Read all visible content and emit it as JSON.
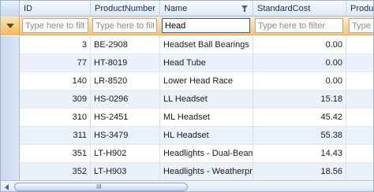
{
  "columns": [
    {
      "key": "id",
      "label": "ID",
      "filter_value": "",
      "filter_placeholder": "Type here to filter"
    },
    {
      "key": "product_number",
      "label": "ProductNumber",
      "filter_value": "",
      "filter_placeholder": "Type here to filter"
    },
    {
      "key": "name",
      "label": "Name",
      "filter_value": "Head",
      "filter_placeholder": "Type here to filter",
      "filtered": true
    },
    {
      "key": "standard_cost",
      "label": "StandardCost",
      "filter_value": "",
      "filter_placeholder": "Type here to filter"
    },
    {
      "key": "product_more",
      "label": "Product",
      "filter_value": "",
      "filter_placeholder": "Type here to filter"
    }
  ],
  "rows": [
    {
      "id": "3",
      "product_number": "BE-2908",
      "name": "Headset Ball Bearings",
      "standard_cost": "0.00"
    },
    {
      "id": "77",
      "product_number": "HT-8019",
      "name": "Head Tube",
      "standard_cost": "0.00"
    },
    {
      "id": "140",
      "product_number": "LR-8520",
      "name": "Lower Head Race",
      "standard_cost": "0.00"
    },
    {
      "id": "309",
      "product_number": "HS-0296",
      "name": "LL Headset",
      "standard_cost": "15.18"
    },
    {
      "id": "310",
      "product_number": "HS-2451",
      "name": "ML Headset",
      "standard_cost": "45.42"
    },
    {
      "id": "311",
      "product_number": "HS-3479",
      "name": "HL Headset",
      "standard_cost": "55.38"
    },
    {
      "id": "351",
      "product_number": "LT-H902",
      "name": "Headlights - Dual-Beam",
      "standard_cost": "14.43"
    },
    {
      "id": "352",
      "product_number": "LT-H903",
      "name": "Headlights - Weatherproof",
      "standard_cost": "18.56"
    }
  ],
  "scrollbar": {
    "grip": "III"
  },
  "colors": {
    "filter_row": "#f9c77a",
    "header": "#dfe8f5",
    "alt_row": "#eaf1fb",
    "active_border": "#1e5fb4"
  },
  "icons": {
    "filter_row_icon": "filter-funnel-icon",
    "column_filter_icon": "filter-funnel-icon"
  }
}
